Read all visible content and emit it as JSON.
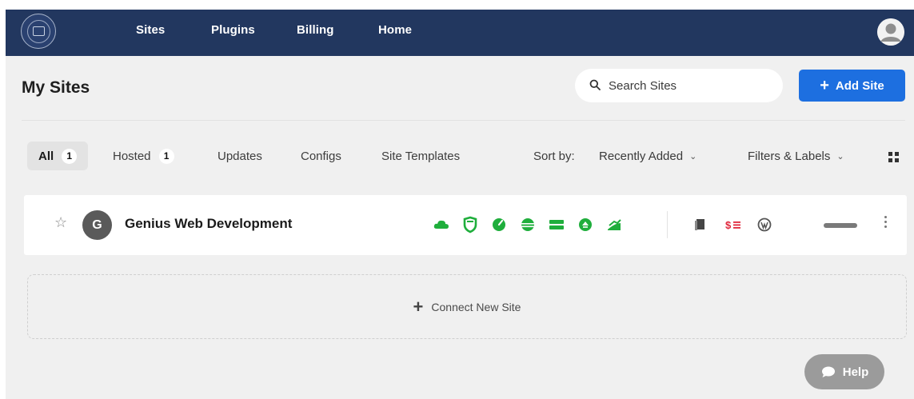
{
  "nav": {
    "links": [
      "Sites",
      "Plugins",
      "Billing",
      "Home"
    ]
  },
  "header": {
    "title": "My Sites",
    "search_placeholder": "Search Sites",
    "add_label": "Add Site"
  },
  "tabs": {
    "all_label": "All",
    "all_count": "1",
    "hosted_label": "Hosted",
    "hosted_count": "1",
    "updates_label": "Updates",
    "configs_label": "Configs",
    "templates_label": "Site Templates"
  },
  "sort": {
    "label": "Sort by:",
    "value": "Recently Added"
  },
  "filters_label": "Filters & Labels",
  "site": {
    "initial": "G",
    "name": "Genius Web Development",
    "status_icons": [
      "cloud-icon",
      "shield-icon",
      "gauge-icon",
      "globe-icon",
      "server-icon",
      "sync-icon",
      "chart-icon"
    ],
    "tool_icons": [
      "copy-icon",
      "billing-icon",
      "wordpress-icon"
    ]
  },
  "connect_label": "Connect New Site",
  "help_label": "Help",
  "colors": {
    "nav_bg": "#22375f",
    "accent": "#1d6fe0",
    "status_green": "#1fae3c",
    "billing_red": "#e0263b"
  }
}
